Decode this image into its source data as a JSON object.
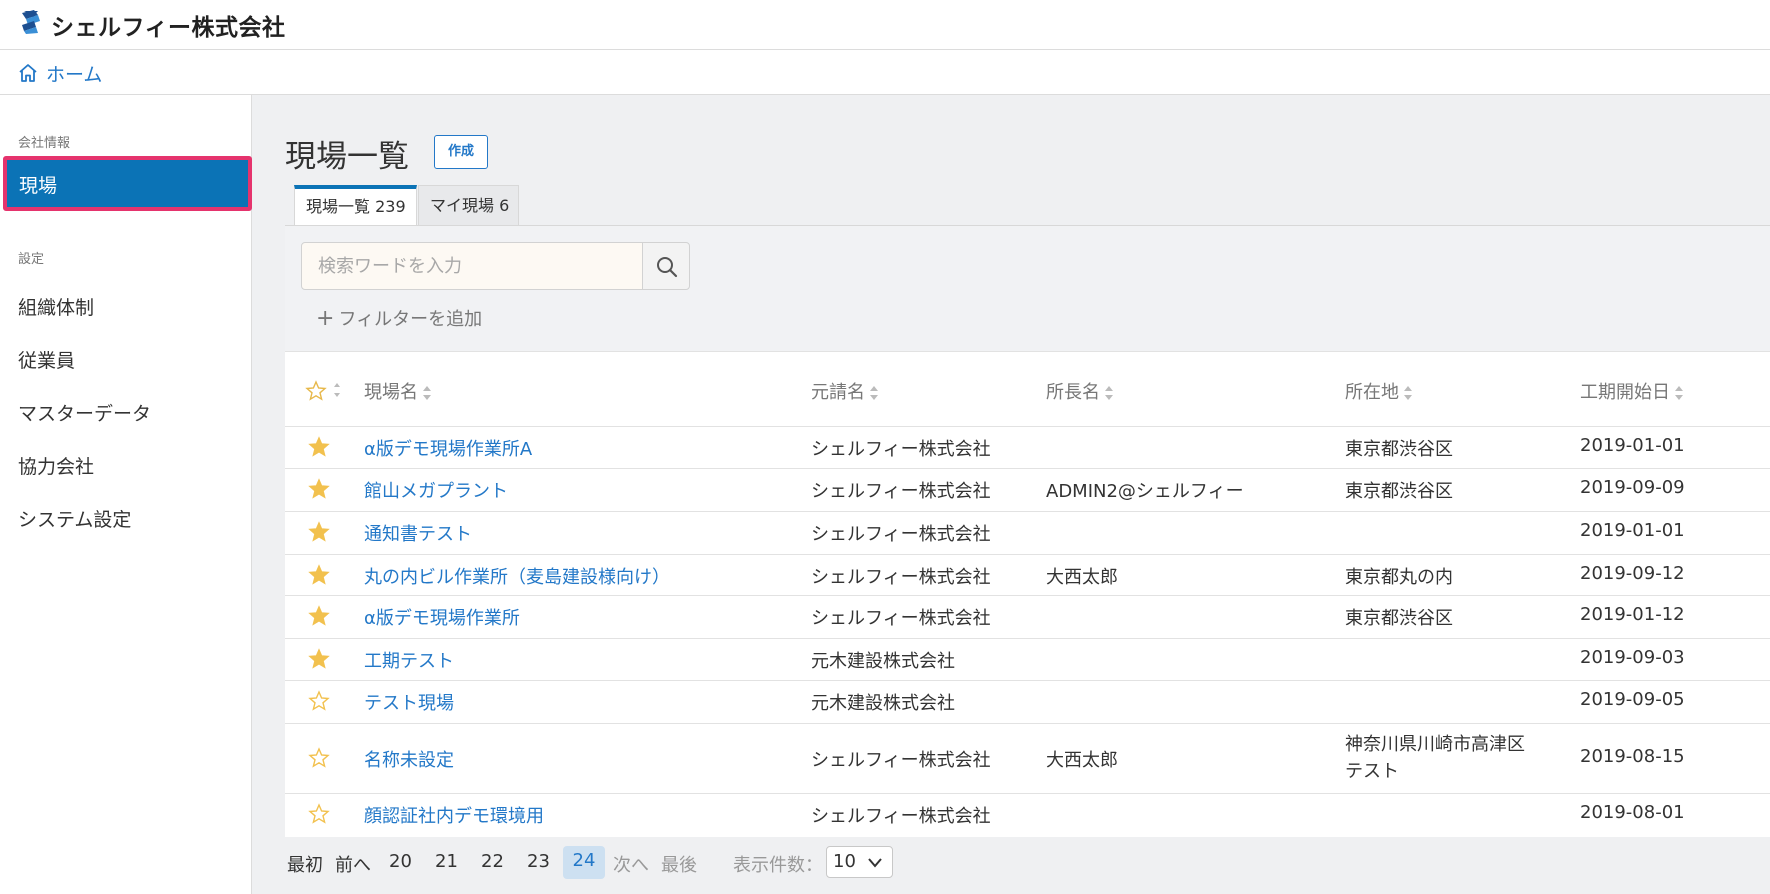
{
  "header": {
    "company": "シェルフィー株式会社",
    "logo": "shelfy-logo"
  },
  "breadcrumb": {
    "home": "ホーム"
  },
  "sidebar": {
    "section_company": "会社情報",
    "active_item": "現場",
    "section_settings": "設定",
    "items": [
      "組織体制",
      "従業員",
      "マスターデータ",
      "協力会社",
      "システム設定"
    ]
  },
  "page": {
    "title": "現場一覧",
    "create_label": "作成"
  },
  "tabs": [
    {
      "label": "現場一覧 239"
    },
    {
      "label": "マイ現場 6"
    }
  ],
  "search": {
    "placeholder": "検索ワードを入力",
    "add_filter": "フィルターを追加"
  },
  "table": {
    "headers": {
      "name": "現場名",
      "contractor": "元請名",
      "director": "所長名",
      "address": "所在地",
      "start": "工期開始日"
    },
    "rows": [
      {
        "favorite": true,
        "name": "α版デモ現場作業所A",
        "contractor": "シェルフィー株式会社",
        "director": "",
        "address": "東京都渋谷区",
        "address2": "",
        "start": "2019-01-01"
      },
      {
        "favorite": true,
        "name": "館山メガプラント",
        "contractor": "シェルフィー株式会社",
        "director": "ADMIN2@シェルフィー",
        "address": "東京都渋谷区",
        "address2": "",
        "start": "2019-09-09"
      },
      {
        "favorite": true,
        "name": "通知書テスト",
        "contractor": "シェルフィー株式会社",
        "director": "",
        "address": "",
        "address2": "",
        "start": "2019-01-01"
      },
      {
        "favorite": true,
        "name": "丸の内ビル作業所（麦島建設様向け）",
        "contractor": "シェルフィー株式会社",
        "director": "大西太郎",
        "address": "東京都丸の内",
        "address2": "",
        "start": "2019-09-12"
      },
      {
        "favorite": true,
        "name": "α版デモ現場作業所",
        "contractor": "シェルフィー株式会社",
        "director": "",
        "address": "東京都渋谷区",
        "address2": "",
        "start": "2019-01-12"
      },
      {
        "favorite": true,
        "name": "工期テスト",
        "contractor": "元木建設株式会社",
        "director": "",
        "address": "",
        "address2": "",
        "start": "2019-09-03"
      },
      {
        "favorite": false,
        "name": "テスト現場",
        "contractor": "元木建設株式会社",
        "director": "",
        "address": "",
        "address2": "",
        "start": "2019-09-05"
      },
      {
        "favorite": false,
        "name": "名称未設定",
        "contractor": "シェルフィー株式会社",
        "director": "大西太郎",
        "address": "神奈川県川崎市高津区",
        "address2": "テスト",
        "start": "2019-08-15"
      },
      {
        "favorite": false,
        "name": "顔認証社内デモ環境用",
        "contractor": "シェルフィー株式会社",
        "director": "",
        "address": "",
        "address2": "",
        "start": "2019-08-01"
      }
    ]
  },
  "pagination": {
    "first": "最初",
    "prev": "前へ",
    "pages": [
      "20",
      "21",
      "22",
      "23"
    ],
    "current": "24",
    "next": "次へ",
    "last": "最後",
    "per_page_label": "表示件数：",
    "per_page_value": "10"
  },
  "colors": {
    "primary": "#0b73b6",
    "link": "#2378c8",
    "highlight": "#e5336d",
    "star": "#f2c14e"
  }
}
